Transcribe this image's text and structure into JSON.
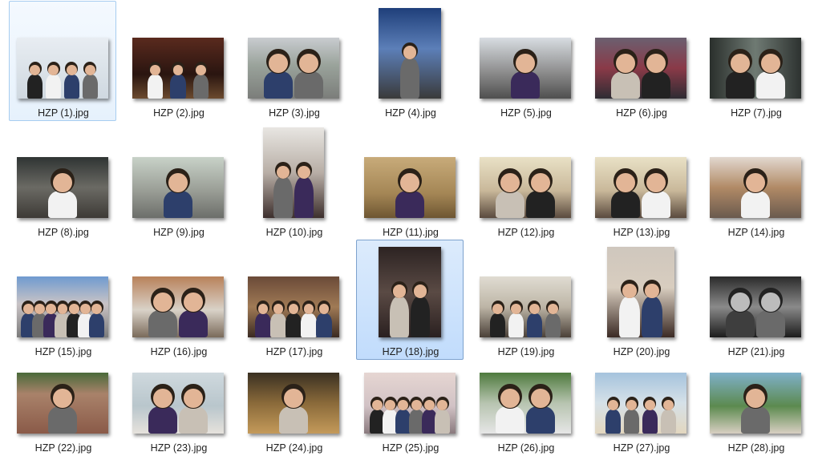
{
  "files": [
    {
      "name": "HZP (1).jpg",
      "state": "focus",
      "scene": "selfie"
    },
    {
      "name": "HZP (2).jpg",
      "scene": "casino"
    },
    {
      "name": "HZP (3).jpg",
      "scene": "parking"
    },
    {
      "name": "HZP (4).jpg",
      "scene": "tent-night"
    },
    {
      "name": "HZP (5).jpg",
      "scene": "building"
    },
    {
      "name": "HZP (6).jpg",
      "scene": "stadium"
    },
    {
      "name": "HZP (7).jpg",
      "scene": "window"
    },
    {
      "name": "HZP (8).jpg",
      "scene": "market"
    },
    {
      "name": "HZP (9).jpg",
      "scene": "street"
    },
    {
      "name": "HZP (10).jpg",
      "scene": "indoor-white"
    },
    {
      "name": "HZP (11).jpg",
      "scene": "indoor-warm"
    },
    {
      "name": "HZP (12).jpg",
      "scene": "room"
    },
    {
      "name": "HZP (13).jpg",
      "scene": "room"
    },
    {
      "name": "HZP (14).jpg",
      "scene": "kitchen"
    },
    {
      "name": "HZP (15).jpg",
      "scene": "tent-day"
    },
    {
      "name": "HZP (16).jpg",
      "scene": "study"
    },
    {
      "name": "HZP (17).jpg",
      "scene": "restaurant"
    },
    {
      "name": "HZP (18).jpg",
      "state": "selected",
      "scene": "formal"
    },
    {
      "name": "HZP (19).jpg",
      "scene": "group-room"
    },
    {
      "name": "HZP (20).jpg",
      "scene": "graduation"
    },
    {
      "name": "HZP (21).jpg",
      "scene": "bw"
    },
    {
      "name": "HZP (22).jpg",
      "scene": "brick"
    },
    {
      "name": "HZP (23).jpg",
      "scene": "beach-close"
    },
    {
      "name": "HZP (24).jpg",
      "scene": "guitar"
    },
    {
      "name": "HZP (25).jpg",
      "scene": "group-indoor"
    },
    {
      "name": "HZP (26).jpg",
      "scene": "tropical"
    },
    {
      "name": "HZP (27).jpg",
      "scene": "beach"
    },
    {
      "name": "HZP (28).jpg",
      "scene": "sculpture"
    }
  ],
  "colors": {
    "focus_fill": "#e6f1fc",
    "focus_border": "#a7cdf0",
    "selected_fill": "#c1dcfc",
    "selected_border": "#7da2ce"
  }
}
